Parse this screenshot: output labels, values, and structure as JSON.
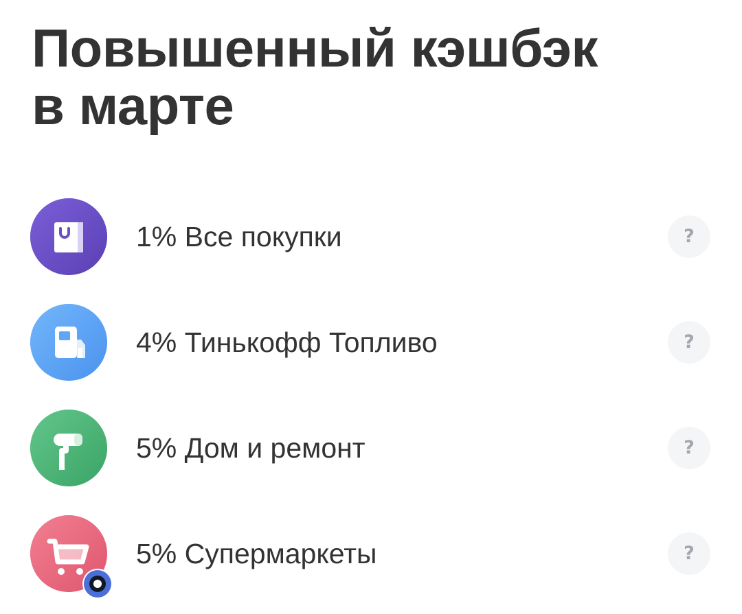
{
  "header": {
    "title_line1": "Повышенный кэшбэк",
    "title_line2": "в марте"
  },
  "cashback": {
    "items": [
      {
        "label": "1% Все покупки",
        "icon": "shopping-bag-icon",
        "color": "#6a4fc7"
      },
      {
        "label": "4% Тинькофф Топливо",
        "icon": "fuel-pump-icon",
        "color": "#5ea6f8"
      },
      {
        "label": "5% Дом и ремонт",
        "icon": "paint-roller-icon",
        "color": "#4db577"
      },
      {
        "label": "5% Супермаркеты",
        "icon": "shopping-cart-icon",
        "color": "#ec6b7f"
      }
    ],
    "help_glyph": "?"
  },
  "colors": {
    "text": "#333333",
    "help_bg": "#f4f5f6",
    "help_fg": "#a4a8ae",
    "badge_ring": "#4a6fd6"
  }
}
